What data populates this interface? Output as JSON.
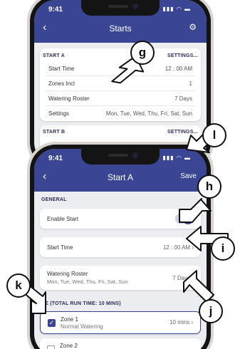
{
  "back_screen": {
    "time": "9:41",
    "title": "Starts",
    "section_a": {
      "heading": "START A",
      "settings_link": "SETTINGS..."
    },
    "rows": [
      {
        "label": "Start Time",
        "value": "12 : 00 AM"
      },
      {
        "label": "Zones Incl",
        "value": "1"
      },
      {
        "label": "Watering Roster",
        "value": "7 Days"
      },
      {
        "label": "Settings",
        "value": "Mon, Tue, Wed, Thu, Fri, Sat, Sun"
      }
    ],
    "section_b": {
      "heading": "START B",
      "settings_link": "SETTINGS..."
    }
  },
  "front_screen": {
    "time": "9:41",
    "back_icon": "chevron-left-icon",
    "title": "Start A",
    "save_label": "Save",
    "general_heading": "GENERAL",
    "enable_start_label": "Enable Start",
    "enable_start_on": true,
    "start_time_label": "Start Time",
    "start_time_value": "12 : 00 AM",
    "watering_roster_label": "Watering Roster",
    "watering_roster_days": "Mon, Tue, Wed, Thu, Fri, Sat, Sun",
    "watering_roster_value": "7 Days",
    "zone_heading": "NE (TOTAL RUN TIME: 10 MINS)",
    "zones": [
      {
        "name": "Zone 1",
        "mode": "Normal Watering",
        "duration": "10 mins",
        "checked": true
      },
      {
        "name": "Zone 2",
        "checked": false
      }
    ]
  },
  "callouts": [
    "g",
    "h",
    "i",
    "j",
    "k",
    "l"
  ],
  "colors": {
    "header": "#3a4694",
    "background": "#ebedf1",
    "accent": "#3a4694"
  }
}
